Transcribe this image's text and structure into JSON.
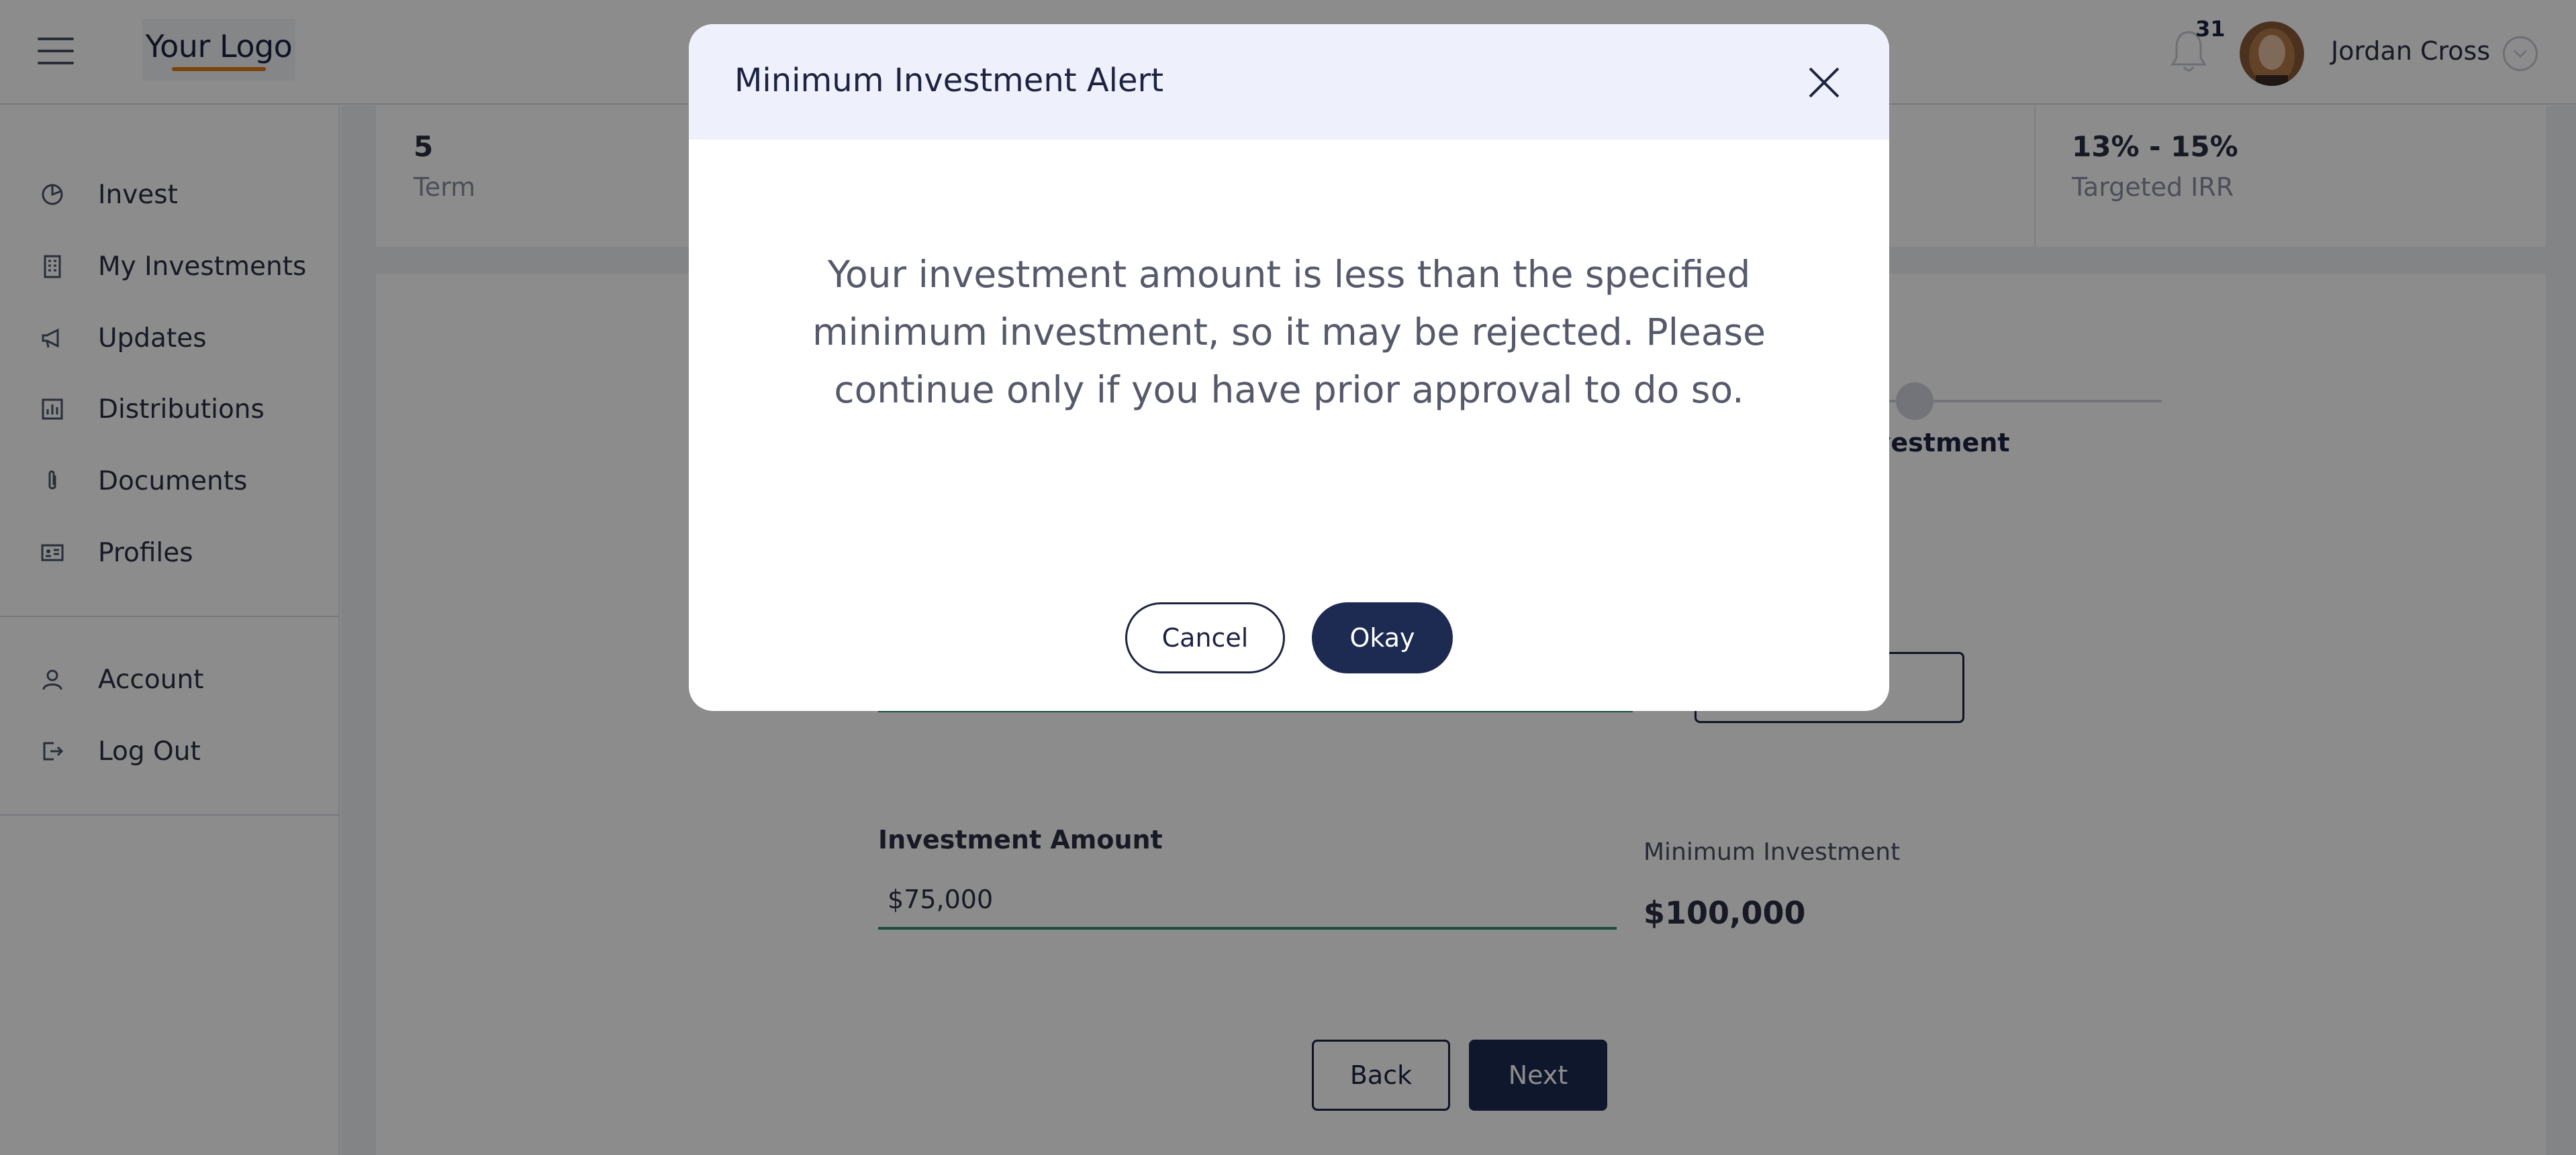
{
  "header": {
    "logo_text": "Your Logo",
    "notification_count": "31",
    "user_name": "Jordan Cross"
  },
  "sidebar": {
    "items": [
      {
        "label": "Invest",
        "icon": "pie-chart-icon"
      },
      {
        "label": "My Investments",
        "icon": "building-icon"
      },
      {
        "label": "Updates",
        "icon": "megaphone-icon"
      },
      {
        "label": "Distributions",
        "icon": "bar-chart-icon"
      },
      {
        "label": "Documents",
        "icon": "paperclip-icon"
      },
      {
        "label": "Profiles",
        "icon": "id-card-icon"
      }
    ],
    "account_items": [
      {
        "label": "Account",
        "icon": "user-icon"
      },
      {
        "label": "Log Out",
        "icon": "logout-icon"
      }
    ]
  },
  "stats": {
    "term_value": "5",
    "term_label": "Term",
    "irr_value": "13% - 15%",
    "irr_label": "Targeted IRR"
  },
  "form": {
    "step_label": "d Investment",
    "amount_label": "Investment Amount",
    "amount_value": "$75,000",
    "min_label": "Minimum Investment",
    "min_value": "$100,000",
    "back_label": "Back",
    "next_label": "Next"
  },
  "modal": {
    "title": "Minimum Investment Alert",
    "message": "Your investment amount is less than the specified minimum investment, so it may be rejected. Please continue only if you have prior approval to do so.",
    "cancel_label": "Cancel",
    "okay_label": "Okay"
  },
  "colors": {
    "primary": "#1d2b52",
    "accent_green": "#2f8f6b",
    "logo_underline": "#e07a10",
    "modal_header_bg": "#eef1fb"
  }
}
